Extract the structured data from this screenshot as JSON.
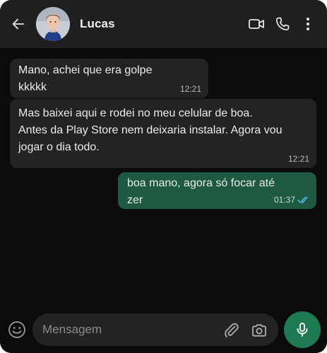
{
  "header": {
    "contact_name": "Lucas",
    "icons": [
      "back-arrow-icon",
      "video-call-icon",
      "phone-icon",
      "more-options-icon"
    ]
  },
  "messages": [
    {
      "direction": "incoming",
      "lines": [
        "Mano, achei que era golpe",
        "kkkkk"
      ],
      "time": "12:21"
    },
    {
      "direction": "incoming",
      "lines": [
        "Mas baixei aqui e rodei no meu celular de boa.",
        "Antes da Play Store nem deixaria instalar. Agora vou",
        "jogar o dia todo."
      ],
      "time": "12:21"
    },
    {
      "direction": "outgoing",
      "lines": [
        "boa mano, agora só focar até",
        "zer"
      ],
      "time": "01:37",
      "status": "read"
    }
  ],
  "composer": {
    "placeholder": "Mensagem",
    "icons": [
      "emoji-icon",
      "attach-icon",
      "camera-icon",
      "mic-icon"
    ]
  },
  "colors": {
    "background": "#0b0b0b",
    "header": "#1f1f1f",
    "incoming_bubble": "#232323",
    "outgoing_bubble": "#1d5a41",
    "accent": "#1e7a52",
    "read_ticks": "#53bdeb"
  }
}
